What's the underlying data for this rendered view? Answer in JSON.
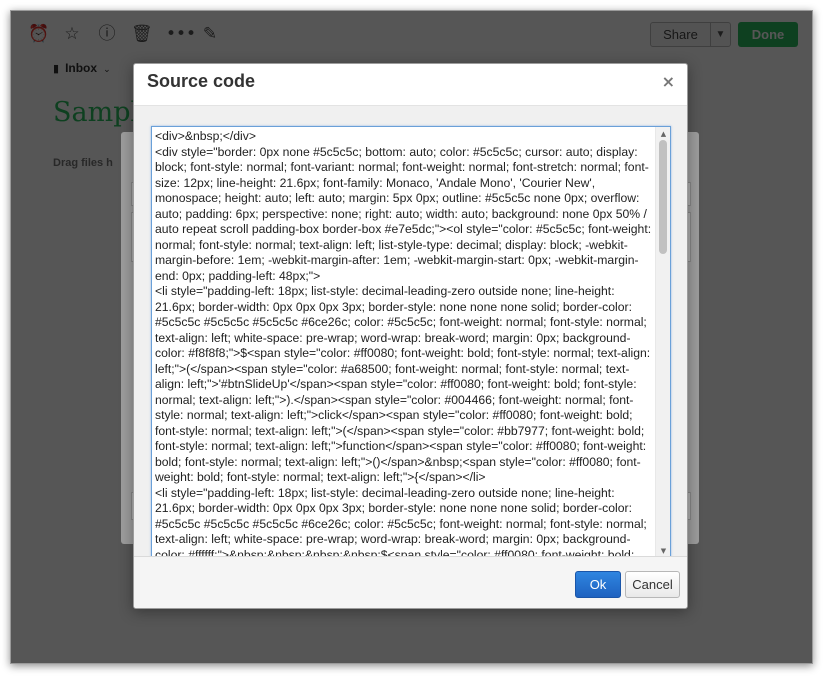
{
  "toolbar": {
    "share_label": "Share",
    "done_label": "Done"
  },
  "notebook": {
    "label": "Inbox"
  },
  "note": {
    "title": "Sample",
    "drag_hint": "Drag files h"
  },
  "modal": {
    "title": "Source code",
    "close_symbol": "×",
    "code": "<div>&nbsp;</div>\n<div style=\"border: 0px none #5c5c5c; bottom: auto; color: #5c5c5c; cursor: auto; display: block; font-style: normal; font-variant: normal; font-weight: normal; font-stretch: normal; font-size: 12px; line-height: 21.6px; font-family: Monaco, 'Andale Mono', 'Courier New', monospace; height: auto; left: auto; margin: 5px 0px; outline: #5c5c5c none 0px; overflow: auto; padding: 6px; perspective: none; right: auto; width: auto; background: none 0px 50% / auto repeat scroll padding-box border-box #e7e5dc;\"><ol style=\"color: #5c5c5c; font-weight: normal; font-style: normal; text-align: left; list-style-type: decimal; display: block; -webkit-margin-before: 1em; -webkit-margin-after: 1em; -webkit-margin-start: 0px; -webkit-margin-end: 0px; padding-left: 48px;\">\n<li style=\"padding-left: 18px; list-style: decimal-leading-zero outside none; line-height: 21.6px; border-width: 0px 0px 0px 3px; border-style: none none none solid; border-color: #5c5c5c #5c5c5c #5c5c5c #6ce26c; color: #5c5c5c; font-weight: normal; font-style: normal; text-align: left; white-space: pre-wrap; word-wrap: break-word; margin: 0px; background-color: #f8f8f8;\">$<span style=\"color: #ff0080; font-weight: bold; font-style: normal; text-align: left;\">(</span><span style=\"color: #a68500; font-weight: normal; font-style: normal; text-align: left;\">'#btnSlideUp'</span><span style=\"color: #ff0080; font-weight: bold; font-style: normal; text-align: left;\">).</span><span style=\"color: #004466; font-weight: normal; font-style: normal; text-align: left;\">click</span><span style=\"color: #ff0080; font-weight: bold; font-style: normal; text-align: left;\">(</span><span style=\"color: #bb7977; font-weight: bold; font-style: normal; text-align: left;\">function</span><span style=\"color: #ff0080; font-weight: bold; font-style: normal; text-align: left;\">()</span>&nbsp;<span style=\"color: #ff0080; font-weight: bold; font-style: normal; text-align: left;\">{</span></li>\n<li style=\"padding-left: 18px; list-style: decimal-leading-zero outside none; line-height: 21.6px; border-width: 0px 0px 0px 3px; border-style: none none none solid; border-color: #5c5c5c #5c5c5c #5c5c5c #6ce26c; color: #5c5c5c; font-weight: normal; font-style: normal; text-align: left; white-space: pre-wrap; word-wrap: break-word; margin: 0px; background-color: #ffffff;\">&nbsp;&nbsp;&nbsp;&nbsp;$<span style=\"color: #ff0080; font-weight: bold; font-style: normal; text-align: left;\">(</span><span style=\"color: #a68500; font-weight: normal; font-style: normal; text-align: left;\">'#slideMe'</span><span style=\"color: #ff0080; font-weight: bold; font-style: normal; text-align: left;\">).</span><span style=\"color: #004466;",
    "ok_label": "Ok",
    "cancel_label": "Cancel"
  }
}
